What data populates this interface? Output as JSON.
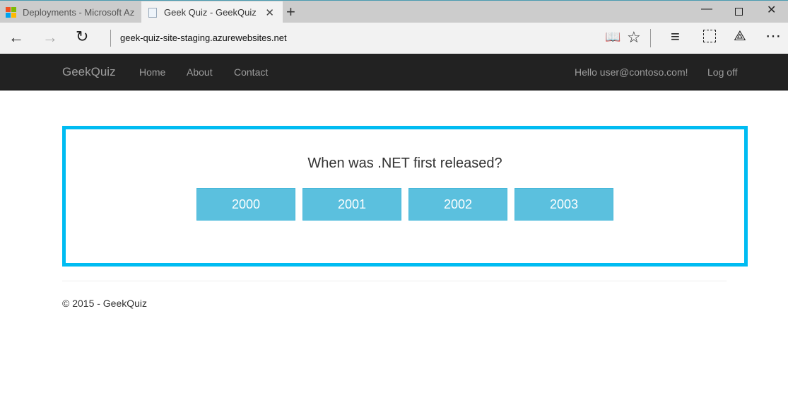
{
  "browser": {
    "tabs": [
      {
        "title": "Deployments - Microsoft Az"
      },
      {
        "title": "Geek Quiz - GeekQuiz"
      }
    ],
    "address": "geek-quiz-site-staging.azurewebsites.net"
  },
  "site": {
    "brand": "GeekQuiz",
    "nav": [
      "Home",
      "About",
      "Contact"
    ],
    "greeting": "Hello user@contoso.com!",
    "logoff": "Log off"
  },
  "quiz": {
    "question": "When was .NET first released?",
    "options": [
      "2000",
      "2001",
      "2002",
      "2003"
    ],
    "accent": "#00bcf2",
    "button_color": "#5bc0de"
  },
  "footer": "© 2015 - GeekQuiz"
}
